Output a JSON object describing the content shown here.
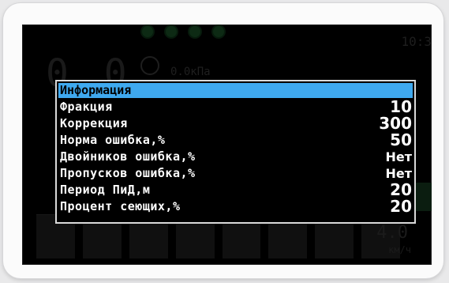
{
  "menu": {
    "title": "Информация",
    "items": [
      {
        "label": "Фракция",
        "value": "10"
      },
      {
        "label": "Коррекция",
        "value": "300"
      },
      {
        "label": "Норма ошибка,%",
        "value": "50"
      },
      {
        "label": "Двойников ошибка,%",
        "value": "Нет"
      },
      {
        "label": "Пропусков ошибка,%",
        "value": "Нет"
      },
      {
        "label": "Период ПиД,м",
        "value": "20"
      },
      {
        "label": "Процент сеющих,%",
        "value": "20"
      }
    ]
  },
  "background": {
    "digits": "0.0",
    "pressure": "0.0кПа",
    "clock": "10:3",
    "speed": "4.0",
    "speed_unit": "км/ч"
  },
  "colors": {
    "highlight": "#3fa9ef",
    "screen": "#000000",
    "frame": "#fbfbfb"
  }
}
